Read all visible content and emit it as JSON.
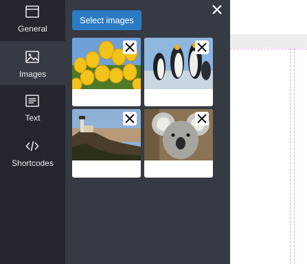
{
  "sidebar": {
    "items": [
      {
        "label": "General",
        "icon": "window-icon"
      },
      {
        "label": "Images",
        "icon": "image-icon"
      },
      {
        "label": "Text",
        "icon": "text-lines-icon"
      },
      {
        "label": "Shortcodes",
        "icon": "code-icon"
      }
    ],
    "active_item": "Images"
  },
  "panel": {
    "select_button_label": "Select images",
    "close_icon": "close-icon",
    "images": [
      {
        "subject": "Yellow tulips",
        "remove_icon": "close-icon"
      },
      {
        "subject": "Penguins",
        "remove_icon": "close-icon"
      },
      {
        "subject": "Lighthouse",
        "remove_icon": "close-icon"
      },
      {
        "subject": "Koala",
        "remove_icon": "close-icon"
      }
    ]
  },
  "colors": {
    "sidebar_bg": "#23262d",
    "panel_bg": "#363a42",
    "accent_button": "#2b7bc4",
    "guide_lines": "#d9a7ea"
  }
}
